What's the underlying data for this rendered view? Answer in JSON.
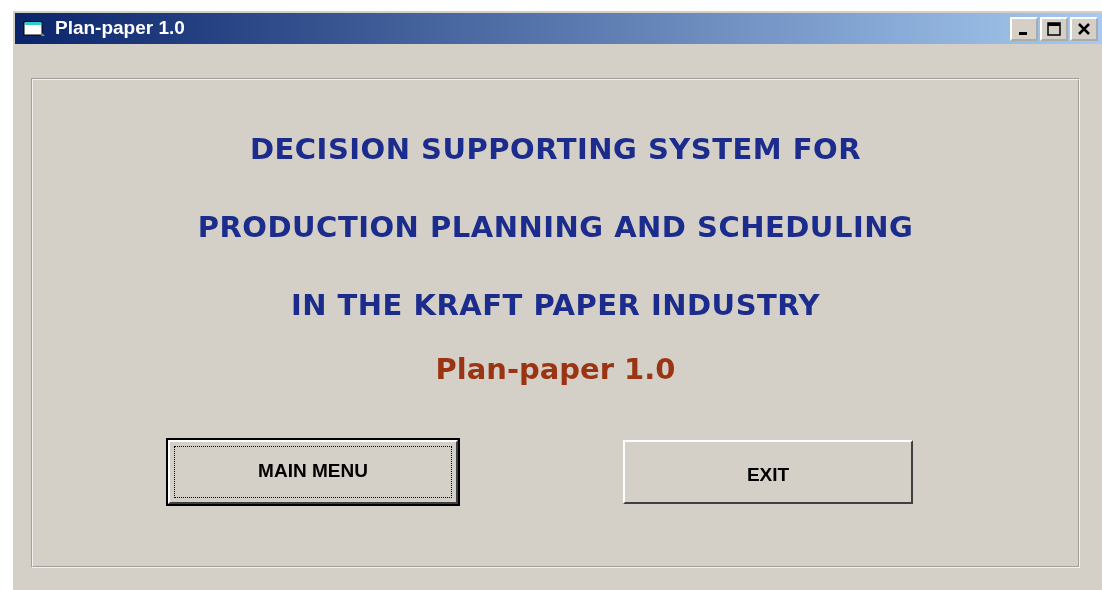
{
  "window": {
    "title": "Plan-paper 1.0"
  },
  "heading_lines": [
    "DECISION SUPPORTING SYSTEM FOR",
    "PRODUCTION PLANNING AND SCHEDULING",
    "IN THE KRAFT PAPER INDUSTRY"
  ],
  "version_label": "Plan-paper 1.0",
  "buttons": [
    {
      "label": "MAIN MENU",
      "focused": true
    },
    {
      "label": "EXIT",
      "focused": false
    }
  ]
}
